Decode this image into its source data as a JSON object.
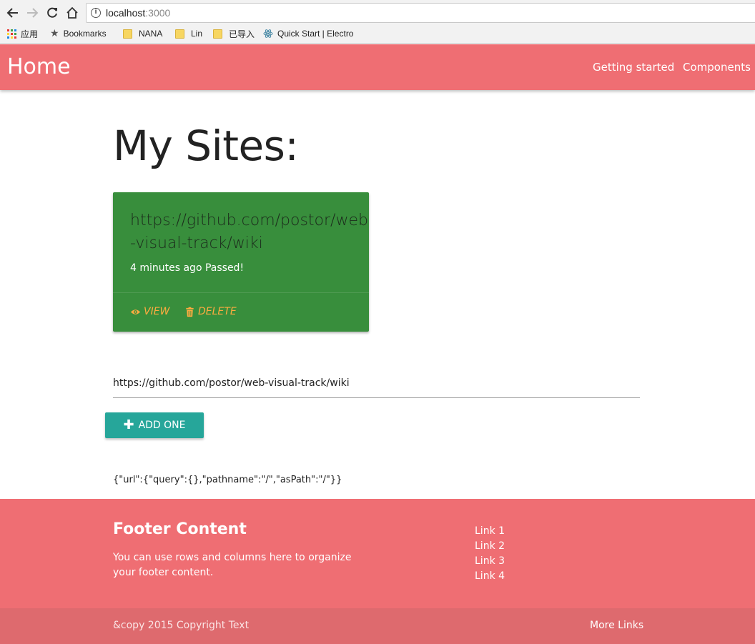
{
  "browser": {
    "url_host": "localhost",
    "url_port": ":3000",
    "bookmarks": [
      {
        "label": "应用",
        "icon": "apps-grid-icon"
      },
      {
        "label": "Bookmarks",
        "icon": "star-icon"
      },
      {
        "label": "NANA",
        "icon": "folder-icon"
      },
      {
        "label": "Lin",
        "icon": "folder-icon"
      },
      {
        "label": "已导入",
        "icon": "folder-icon"
      },
      {
        "label": "Quick Start | Electro",
        "icon": "electron-icon"
      }
    ]
  },
  "nav": {
    "brand": "Home",
    "links": [
      "Getting started",
      "Components"
    ],
    "color": "#ef6e73"
  },
  "main": {
    "title": "My Sites:",
    "card": {
      "title": "https://github.com/postor/web-visual-track/wiki",
      "status": "4 minutes ago Passed!",
      "view_label": "VIEW",
      "delete_label": "DELETE",
      "color": "#388e3c",
      "action_color": "#ffab40"
    },
    "input_value": "https://github.com/postor/web-visual-track/wiki",
    "add_button_label": "ADD ONE",
    "add_button_color": "#26a69a",
    "json_text": "{\"url\":{\"query\":{},\"pathname\":\"/\",\"asPath\":\"/\"}}"
  },
  "footer": {
    "title": "Footer Content",
    "text": "You can use rows and columns here to organize your footer content.",
    "links": [
      "Link 1",
      "Link 2",
      "Link 3",
      "Link 4"
    ],
    "copyright": "&copy 2015 Copyright Text",
    "more_links": "More Links"
  }
}
